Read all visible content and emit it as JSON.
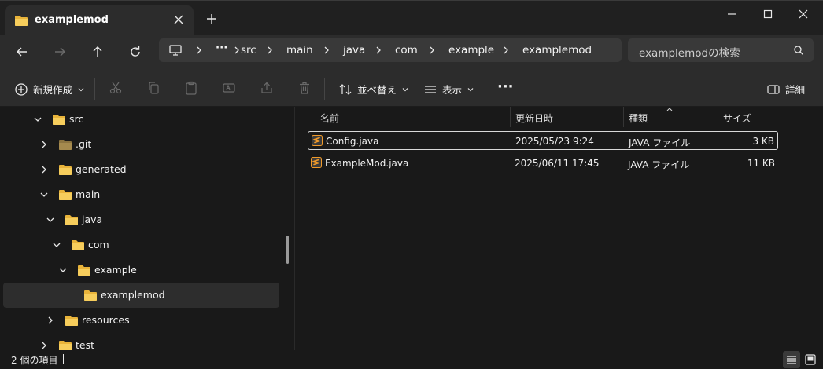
{
  "window": {
    "tab_title": "examplemod",
    "new_tab": "+",
    "controls": [
      "minimize",
      "maximize",
      "close"
    ]
  },
  "address_bar": {
    "overflow": "···",
    "breadcrumbs": [
      "src",
      "main",
      "java",
      "com",
      "example",
      "examplemod"
    ]
  },
  "search": {
    "placeholder": "examplemodの検索"
  },
  "command_bar": {
    "new_label": "新規作成",
    "sort_label": "並べ替え",
    "view_label": "表示",
    "more_label": "···",
    "details_label": "詳細"
  },
  "nav_tree": [
    {
      "label": "src",
      "expanded": true,
      "depth": 0
    },
    {
      "label": ".git",
      "expanded": false,
      "depth": 1,
      "dim": true
    },
    {
      "label": "generated",
      "expanded": false,
      "depth": 1
    },
    {
      "label": "main",
      "expanded": true,
      "depth": 1
    },
    {
      "label": "java",
      "expanded": true,
      "depth": 2
    },
    {
      "label": "com",
      "expanded": true,
      "depth": 3
    },
    {
      "label": "example",
      "expanded": true,
      "depth": 4
    },
    {
      "label": "examplemod",
      "expanded": false,
      "depth": 5,
      "selected": true
    },
    {
      "label": "resources",
      "expanded": false,
      "depth": 2
    },
    {
      "label": "test",
      "expanded": false,
      "depth": 1
    }
  ],
  "columns": {
    "name": "名前",
    "modified": "更新日時",
    "type": "種類",
    "size": "サイズ"
  },
  "files": [
    {
      "name": "Config.java",
      "modified": "2025/05/23 9:24",
      "type": "JAVA ファイル",
      "size": "3 KB"
    },
    {
      "name": "ExampleMod.java",
      "modified": "2025/06/11 17:45",
      "type": "JAVA ファイル",
      "size": "11 KB"
    }
  ],
  "status": {
    "item_count": "2 個の項目"
  },
  "colors": {
    "folder": "#f0c050",
    "accent_file_icon": "#f09a2a"
  }
}
